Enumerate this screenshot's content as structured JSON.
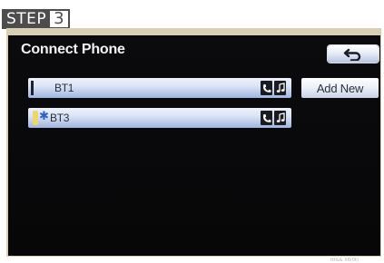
{
  "step": {
    "label": "STEP",
    "number": "3"
  },
  "screen": {
    "title": "Connect Phone",
    "back_button": {
      "icon": "back-arrow-icon"
    },
    "devices": [
      {
        "label": "BT1",
        "icons": [
          "phone-icon",
          "music-note-icon"
        ]
      },
      {
        "label": "BT3",
        "icons": [
          "phone-icon",
          "music-note-icon"
        ],
        "connected_icon": "bluetooth-icon"
      }
    ],
    "add_new_label": "Add New"
  },
  "watermark": "ttt&& X6(0t)",
  "colors": {
    "screen": "#0b0a0d",
    "frame": "#d9cfb2",
    "button_gradient_bottom": "#9fb4df"
  }
}
